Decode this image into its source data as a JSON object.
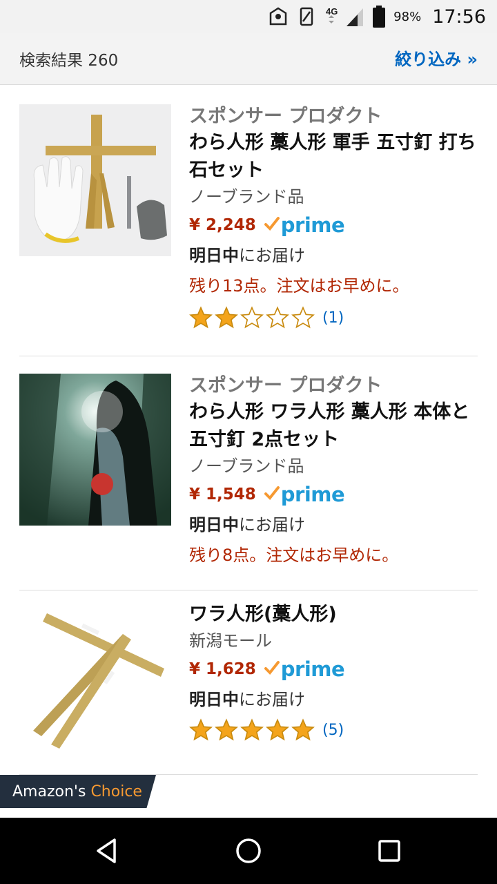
{
  "status_bar": {
    "battery_percent": "98%",
    "time": "17:56",
    "network": "4G",
    "icons": [
      "notification-icon",
      "rotation-icon",
      "signal-icon",
      "battery-icon"
    ]
  },
  "header": {
    "results_label": "検索結果 260",
    "filter_label": "絞り込み »"
  },
  "products": [
    {
      "sponsored": "スポンサー プロダクト",
      "title": "わら人形 藁人形 軍手 五寸釘 打ち石セット",
      "brand": "ノーブランド品",
      "price": "¥ 2,248",
      "prime": "prime",
      "delivery_bold": "明日中",
      "delivery_rest": "にお届け",
      "stock": "残り13点。注文はお早めに。",
      "rating_stars": 2,
      "reviews": "(1)"
    },
    {
      "sponsored": "スポンサー プロダクト",
      "title": "わら人形 ワラ人形 藁人形 本体と五寸釘 2点セット",
      "brand": "ノーブランド品",
      "price": "¥ 1,548",
      "prime": "prime",
      "delivery_bold": "明日中",
      "delivery_rest": "にお届け",
      "stock": "残り8点。注文はお早めに。"
    },
    {
      "title": "ワラ人形(藁人形)",
      "brand": "新潟モール",
      "price": "¥ 1,628",
      "prime": "prime",
      "delivery_bold": "明日中",
      "delivery_rest": "にお届け",
      "rating_stars": 5,
      "reviews": "(5)"
    }
  ],
  "badge": {
    "prefix": "Amazon's",
    "accent": "Choice"
  },
  "colors": {
    "price": "#b12704",
    "link": "#0066c0",
    "prime": "#1f9ad6",
    "prime_check": "#f69931",
    "star": "#f4a41b"
  }
}
